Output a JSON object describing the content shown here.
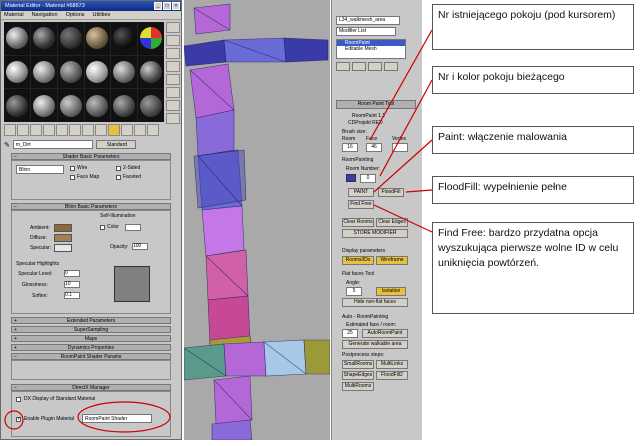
{
  "material_editor": {
    "title": "Material Editor - Material #68673",
    "menu": [
      "Material",
      "Navigation",
      "Options",
      "Utilities"
    ],
    "material_name": "m_Dirt",
    "material_type": "Standard",
    "rollouts": {
      "shader_basic": "Shader Basic Parameters",
      "blinn_basic": "Blinn Basic Parameters",
      "extended": "Extended Parameters",
      "supersampling": "SuperSampling",
      "maps": "Maps",
      "dynamics": "Dynamics Properties",
      "roompaint": "RoomPaint Shader Params",
      "directx": "DirectX Manager"
    },
    "shader": "Blinn",
    "wire": "Wire",
    "two_sided": "2-Sided",
    "face_map": "Face Map",
    "faceted": "Faceted",
    "ambient": "Ambient:",
    "diffuse": "Diffuse:",
    "specular": "Specular:",
    "self_illumination": "Self-Illumination",
    "color": "Color",
    "opacity": "Opacity:",
    "opacity_value": "100",
    "specular_highlights": "Specular Highlights",
    "specular_level": "Specular Level:",
    "glossiness": "Glossiness:",
    "soften": "Soften:",
    "spec_level_val": "0",
    "gloss_val": "10",
    "soften_val": "0.1",
    "dx_display": "DX Display of Standard Material",
    "enable_plugin": "Enable Plugin Material",
    "plugin_name": "RoomPaint Shader"
  },
  "command_panel": {
    "object_name": "L34_walkmesh_area",
    "modifier_list": "Modifier List",
    "stack": [
      "RoomPaint",
      "Editable Mesh"
    ],
    "rollout_title": "Room Paint Tool",
    "roompaint_version": "RoomPaint 1.1",
    "copyright": "CDProjekt RED",
    "brush_size": "Brush size:",
    "room": "Room",
    "face": "Face",
    "vertex": "Vertex",
    "room_val": "16",
    "face_val": "46",
    "room_painting": "RoomPainting",
    "room_number": "Room Number:",
    "room_number_val": "0",
    "paint": "PAINT",
    "floodfill": "FloodFill",
    "find_free": "Find Free",
    "clear_rooms": "Clear Rooms",
    "clear_edges": "Clear Edges",
    "store_modifier": "STORE MODIFIER",
    "display_params": "Display parameters",
    "rooms_ids": "Rooms/IDs",
    "wireframe": "Wireframe",
    "flat_faces": "Flat faces Tool",
    "angle": "Angle:",
    "angle_val": "5",
    "isolation": "Isolation",
    "hide_nonflat": "Hide non-flat faces",
    "auto_roompainting": "Auto - RoomPainting",
    "estimated": "Estimated face / room:",
    "estimated_val": "25",
    "auto_roompaint": "AutoRoomPaint",
    "generate_walkable": "Generate walkable area",
    "postprocess": "Postprocess steps:",
    "small_rooms": "SmallRooms",
    "multi_links": "MultiLinks",
    "shape_edges": "ShapeEdges",
    "flood_fill_2": "FloodFill2",
    "multi_rooms": "MultiRooms"
  },
  "callouts": [
    "Nr istniejącego pokoju (pod kursorem)",
    "Nr i kolor pokoju bieżącego",
    "Paint: włączenie malowania",
    "FloodFill: wypełnienie pełne",
    "Find Free: bardzo przydatna opcja wyszukująca pierwsze wolne ID w celu uniknięcia powtórzeń."
  ],
  "colors": {
    "accent_yellow": "#e8c040",
    "annotation_red": "#cc0000",
    "title_blue": "#0a2a8a"
  }
}
